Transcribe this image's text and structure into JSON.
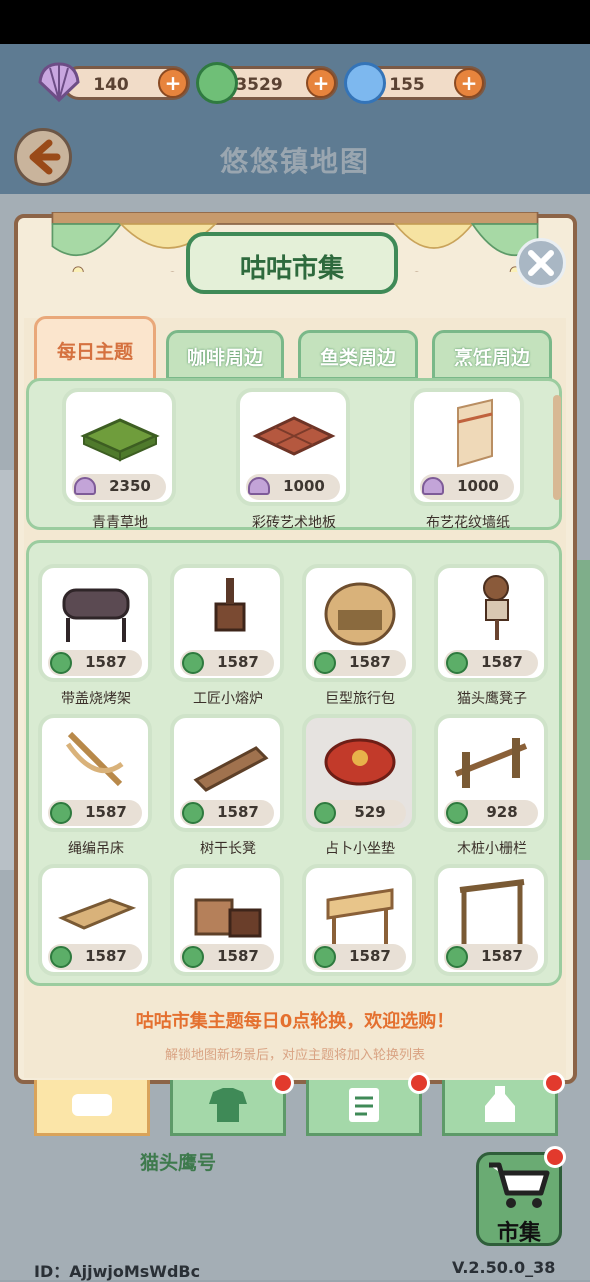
{
  "currencies": {
    "shell": {
      "icon": "shell-icon",
      "value": "140"
    },
    "clover": {
      "icon": "clover-icon",
      "value": "3529"
    },
    "spiral": {
      "icon": "spiral-icon",
      "value": "155"
    },
    "plus_symbol": "+"
  },
  "header": {
    "map_title": "悠悠镇地图"
  },
  "shop": {
    "title": "咕咕市集",
    "tabs": [
      {
        "label": "每日主题",
        "active": true
      },
      {
        "label": "咖啡周边",
        "active": false
      },
      {
        "label": "鱼类周边",
        "active": false
      },
      {
        "label": "烹饪周边",
        "active": false
      }
    ],
    "featured": [
      {
        "name": "青青草地",
        "price": "2350",
        "currency": "shell-icon"
      },
      {
        "name": "彩砖艺术地板",
        "price": "1000",
        "currency": "shell-icon"
      },
      {
        "name": "布艺花纹墙纸",
        "price": "1000",
        "currency": "shell-icon"
      }
    ],
    "items": [
      {
        "name": "带盖烧烤架",
        "price": "1587"
      },
      {
        "name": "工匠小熔炉",
        "price": "1587"
      },
      {
        "name": "巨型旅行包",
        "price": "1587"
      },
      {
        "name": "猫头鹰凳子",
        "price": "1587"
      },
      {
        "name": "绳编吊床",
        "price": "1587"
      },
      {
        "name": "树干长凳",
        "price": "1587"
      },
      {
        "name": "占卜小坐垫",
        "price": "529"
      },
      {
        "name": "木桩小栅栏",
        "price": "928"
      },
      {
        "price": "1587"
      },
      {
        "price": "1587"
      },
      {
        "price": "1587"
      },
      {
        "price": "1587"
      }
    ],
    "note_main": "咕咕市集主题每日0点轮换，欢迎选购！",
    "note_sub": "解锁地图新场景后，对应主题将加入轮换列表"
  },
  "map_label": "猫头鹰号",
  "market_button": {
    "label": "市集"
  },
  "footer": {
    "id_label": "ID：AjjwjoMsWdBc",
    "version": "V.2.50.0_38"
  },
  "colors": {
    "accent_green": "#3f8a57",
    "accent_orange": "#e4702f",
    "badge_red": "#e23a2d"
  }
}
